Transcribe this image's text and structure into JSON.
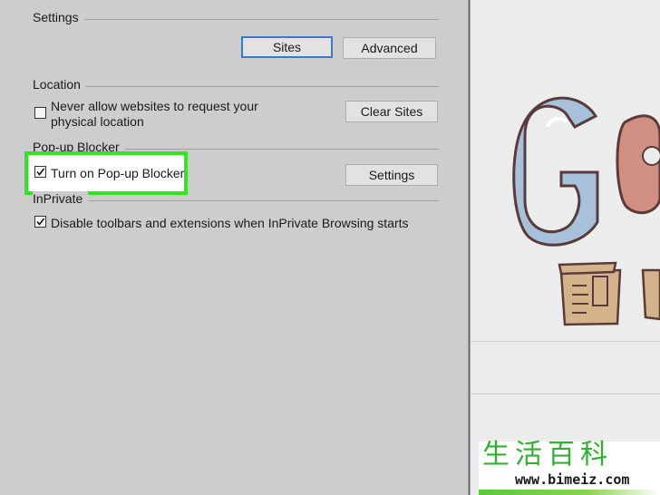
{
  "settings": {
    "header": "Settings",
    "sites_button": "Sites",
    "advanced_button": "Advanced"
  },
  "location": {
    "header": "Location",
    "checkbox_label_line1": "Never allow websites to request your",
    "checkbox_label_line2": "physical location",
    "checked": false,
    "clear_sites_button": "Clear Sites"
  },
  "popup": {
    "header": "Pop-up Blocker",
    "checkbox_label": "Turn on Pop-up Blocker",
    "checked": true,
    "settings_button": "Settings"
  },
  "inprivate": {
    "header": "InPrivate",
    "checkbox_label": "Disable toolbars and extensions when InPrivate Browsing starts",
    "checked": true
  },
  "colors": {
    "highlight": "#30e61e",
    "default_button_border": "#3c78c8"
  },
  "watermark": {
    "chars": "生活百科",
    "url": "www.bimeiz.com"
  }
}
